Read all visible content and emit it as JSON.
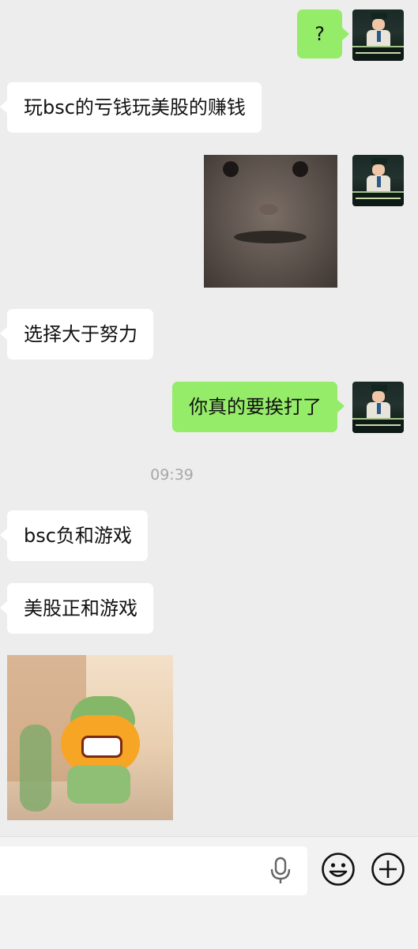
{
  "messages": [
    {
      "side": "right",
      "type": "text",
      "text": "?"
    },
    {
      "side": "left",
      "type": "text",
      "text": "玩bsc的亏钱玩美股的赚钱"
    },
    {
      "side": "right",
      "type": "image",
      "image": "hamster-face-sticker"
    },
    {
      "side": "left",
      "type": "text",
      "text": "选择大于努力"
    },
    {
      "side": "right",
      "type": "text",
      "text": "你真的要挨打了"
    },
    {
      "type": "timestamp",
      "text": "09:39"
    },
    {
      "side": "left",
      "type": "text",
      "text": "bsc负和游戏"
    },
    {
      "side": "left",
      "type": "text",
      "text": "美股正和游戏"
    },
    {
      "side": "left",
      "type": "image",
      "image": "angry-cartoon-sticker"
    }
  ],
  "input_bar": {
    "placeholder": "",
    "icons": [
      "microphone-icon",
      "emoji-icon",
      "plus-icon"
    ]
  },
  "colors": {
    "background": "#ededed",
    "sent_bubble": "#95ec69",
    "received_bubble": "#ffffff",
    "timestamp_text": "#a7a7a7",
    "input_bar": "#f2f2f2"
  }
}
